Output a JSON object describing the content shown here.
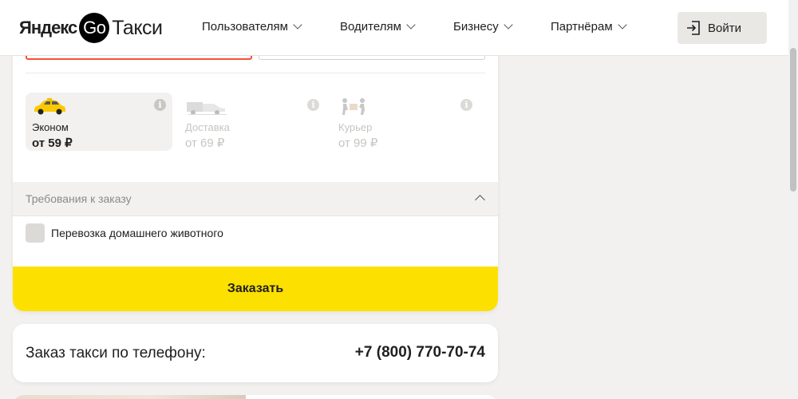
{
  "header": {
    "logo_brand": "Яндекс",
    "logo_go": "Go",
    "logo_service": "Такси",
    "nav": [
      {
        "label": "Пользователям"
      },
      {
        "label": "Водителям"
      },
      {
        "label": "Бизнесу"
      },
      {
        "label": "Партнёрам"
      }
    ],
    "login_label": "Войти"
  },
  "tariffs": [
    {
      "name": "Эконом",
      "price": "от 59 ₽",
      "selected": true,
      "icon": "economy-car-icon"
    },
    {
      "name": "Доставка",
      "price": "от 69 ₽",
      "selected": false,
      "icon": "delivery-van-icon"
    },
    {
      "name": "Курьер",
      "price": "от 99 ₽",
      "selected": false,
      "icon": "courier-icon"
    }
  ],
  "requirements": {
    "title": "Требования к заказу",
    "options": [
      {
        "label": "Перевозка домашнего животного",
        "checked": false
      }
    ]
  },
  "order_button": "Заказать",
  "phone": {
    "label": "Заказ такси по телефону:",
    "number": "+7 (800) 770-70-74"
  },
  "colors": {
    "accent_yellow": "#fce000",
    "error_red": "#f5523a",
    "background": "#f2f1ef"
  }
}
